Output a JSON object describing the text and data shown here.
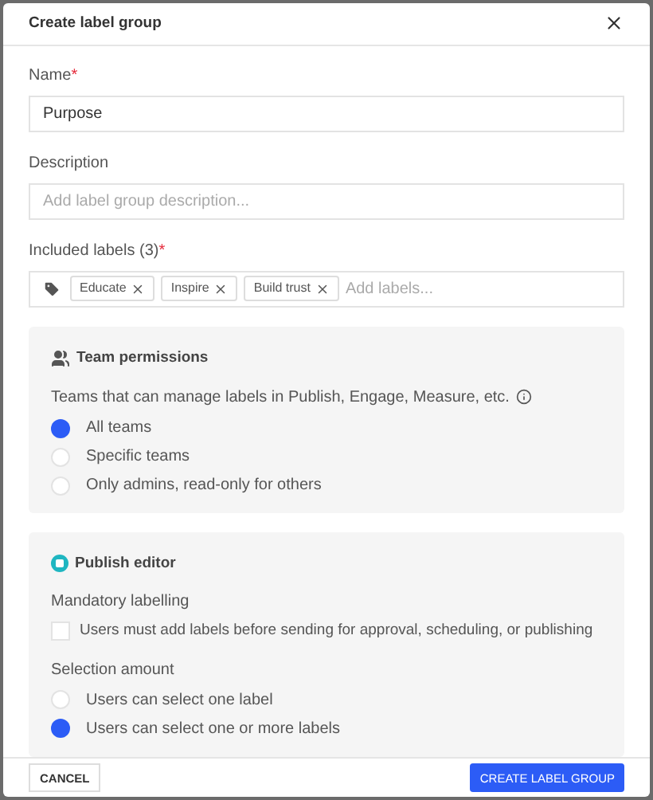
{
  "dialog": {
    "title": "Create label group"
  },
  "fields": [
    {
      "kind": "text",
      "label": "Name",
      "required_mark": "*",
      "value": "Purpose"
    },
    {
      "kind": "text",
      "label": "Description",
      "placeholder": "Add label group description..."
    },
    {
      "kind": "tags",
      "label": "Included labels (3)",
      "required_mark": "*",
      "tags": [
        "Educate",
        "Inspire",
        "Build trust"
      ],
      "placeholder": "Add labels..."
    }
  ],
  "team_permissions": {
    "title": "Team permissions",
    "description": "Teams that can manage labels in Publish, Engage, Measure, etc.",
    "options": [
      {
        "label": "All teams",
        "selected": true
      },
      {
        "label": "Specific teams",
        "selected": false
      },
      {
        "label": "Only admins, read-only for others",
        "selected": false
      }
    ]
  },
  "publish_editor": {
    "title": "Publish editor",
    "mandatory": {
      "label": "Mandatory labelling",
      "checkbox_label": "Users must add labels before sending for approval, scheduling, or publishing",
      "checked": false
    },
    "selection": {
      "label": "Selection amount",
      "options": [
        {
          "label": "Users can select one label",
          "selected": false
        },
        {
          "label": "Users can select one or more labels",
          "selected": true
        }
      ]
    }
  },
  "footer": {
    "cancel": "CANCEL",
    "submit": "CREATE LABEL GROUP"
  }
}
